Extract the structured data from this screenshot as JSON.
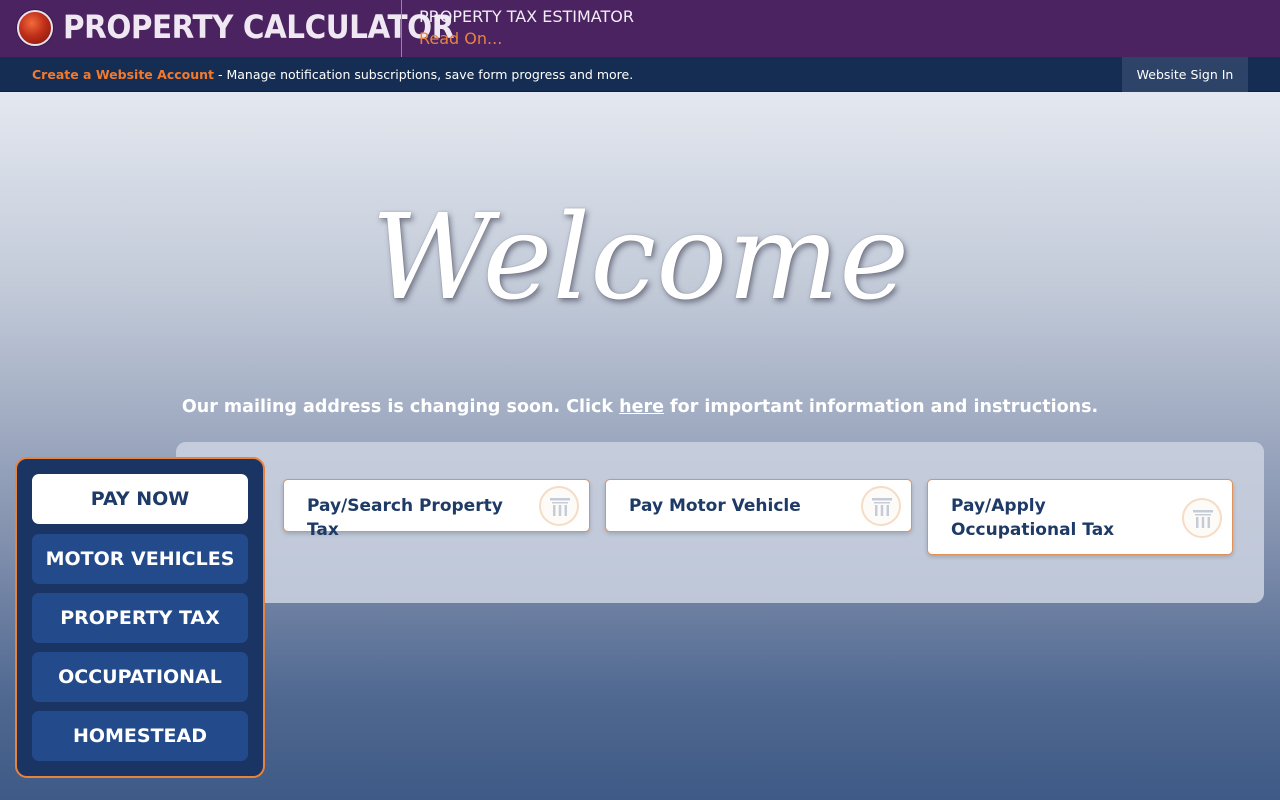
{
  "header": {
    "brand": "PROPERTY CALCULATOR",
    "promo_title": "PROPERTY TAX ESTIMATOR",
    "promo_link": "Read On..."
  },
  "account_bar": {
    "create_link": "Create a Website Account",
    "description": " - Manage notification subscriptions, save form progress and more.",
    "sign_in": "Website Sign In"
  },
  "hero": {
    "welcome": "Welcome",
    "notice_before": "Our mailing address is changing soon. Click ",
    "notice_link": "here",
    "notice_after": " for important information and instructions."
  },
  "cards": [
    {
      "label": "Pay/Search Property Tax",
      "icon": "pillar-icon"
    },
    {
      "label": "Pay Motor Vehicle",
      "icon": "pillar-icon"
    },
    {
      "label": "Pay/Apply Occupational Tax",
      "icon": "pillar-icon"
    }
  ],
  "menu": [
    {
      "label": "PAY NOW",
      "active": true
    },
    {
      "label": "MOTOR VEHICLES"
    },
    {
      "label": "PROPERTY TAX"
    },
    {
      "label": "OCCUPATIONAL"
    },
    {
      "label": "HOMESTEAD"
    }
  ],
  "colors": {
    "header_bg": "#4a2360",
    "account_bar_bg": "#152d52",
    "accent_orange": "#e8833f",
    "menu_bg": "#1a3563",
    "menu_button": "#234b8c",
    "text_dark_blue": "#1e3a66"
  }
}
